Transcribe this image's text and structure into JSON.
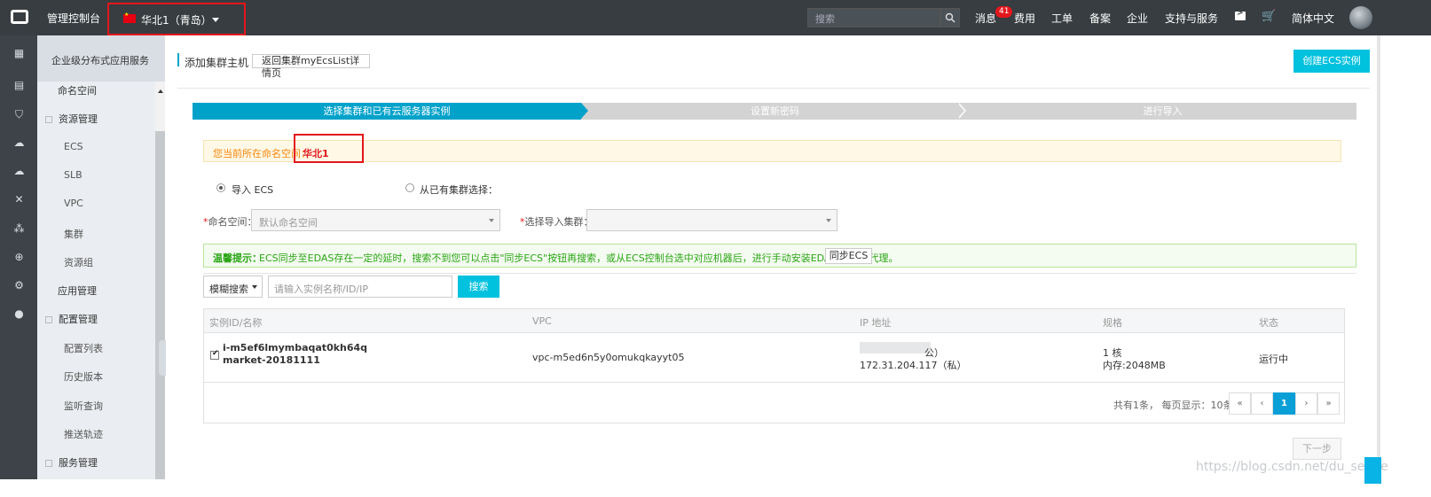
{
  "topbar": {
    "console_title": "管理控制台",
    "region": "华北1（青岛）",
    "search_placeholder": "搜索",
    "nav": {
      "messages": "消息",
      "message_count": "41",
      "fees": "费用",
      "tickets": "工单",
      "filing": "备案",
      "enterprise": "企业",
      "support": "支持与服务",
      "language": "简体中文"
    }
  },
  "rail_icons": [
    "grid-icon",
    "server-icon",
    "shield-icon",
    "cloud-icon",
    "cloud-upload-icon",
    "cross-icon",
    "network-icon",
    "globe-icon",
    "gear-icon",
    "circle-icon"
  ],
  "sidebar": {
    "header": "企业级分布式应用服务",
    "items": [
      {
        "label": "命名空间",
        "type": "item"
      },
      {
        "label": "资源管理",
        "type": "group"
      },
      {
        "label": "ECS",
        "type": "sub"
      },
      {
        "label": "SLB",
        "type": "sub"
      },
      {
        "label": "VPC",
        "type": "sub"
      },
      {
        "label": "集群",
        "type": "sub"
      },
      {
        "label": "资源组",
        "type": "sub"
      },
      {
        "label": "应用管理",
        "type": "item"
      },
      {
        "label": "配置管理",
        "type": "group"
      },
      {
        "label": "配置列表",
        "type": "sub"
      },
      {
        "label": "历史版本",
        "type": "sub"
      },
      {
        "label": "监听查询",
        "type": "sub"
      },
      {
        "label": "推送轨迹",
        "type": "sub"
      },
      {
        "label": "服务管理",
        "type": "group"
      }
    ]
  },
  "main": {
    "title": "添加集群主机",
    "back_button": "返回集群myEcsList详情页",
    "create_button": "创建ECS实例",
    "steps": [
      "选择集群和已有云服务器实例",
      "设置新密码",
      "进行导入"
    ],
    "namespace_notice_label": "您当前所在命名空间：",
    "namespace_notice_value": "华北1",
    "radio_import": "导入 ECS",
    "radio_existing": "从已有集群选择：",
    "namespace_label": "命名空间：",
    "namespace_placeholder": "默认命名空间",
    "cluster_label": "选择导入集群：",
    "tip_title": "温馨提示：",
    "tip_text": "ECS同步至EDAS存在一定的延时，搜索不到您可以点击\"同步ECS\"按钮再搜索，或从ECS控制台选中对应机器后，进行手动安装EDAS Agent代理。",
    "sync_button": "同步ECS",
    "search_mode": "模糊搜索",
    "search_placeholder": "请输入实例名称/ID/IP",
    "search_button": "搜索",
    "table": {
      "headers": [
        "实例ID/名称",
        "VPC",
        "IP 地址",
        "规格",
        "状态"
      ],
      "rows": [
        {
          "id": "i-m5ef6lmymbaqat0kh64q",
          "name": "market-20181111",
          "vpc": "vpc-m5ed6n5y0omukqkayyt05",
          "ip_public": "公）",
          "ip_private": "172.31.204.117（私）",
          "spec_cpu": "1 核",
          "spec_mem": "内存:2048MB",
          "status": "运行中"
        }
      ]
    },
    "pager": {
      "info": "共有1条， 每页显示：10条",
      "first": "«",
      "prev": "‹",
      "current": "1",
      "next": "›",
      "last": "»"
    },
    "next_step": "下一步"
  },
  "watermark": "https://blog.csdn.net/du_senge",
  "colors": {
    "accent": "#00c1de",
    "step_active": "#00a2ca",
    "topbar": "#373d41",
    "highlight_border": "#e3161c"
  }
}
